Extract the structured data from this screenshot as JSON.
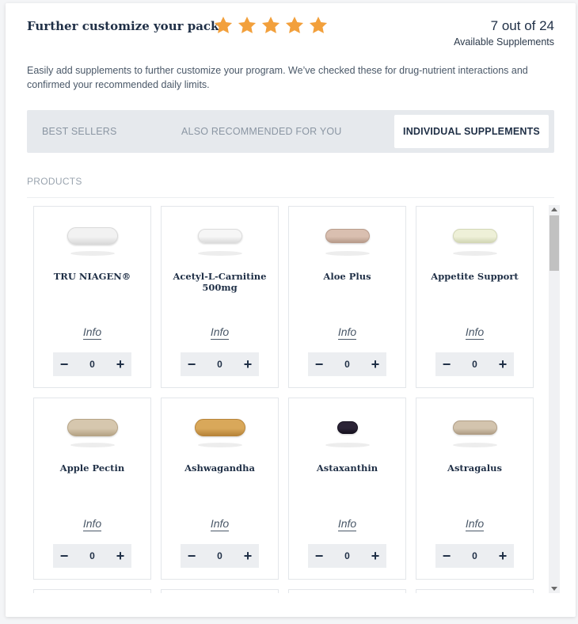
{
  "header": {
    "title": "Further customize your pack",
    "rating_stars": 5,
    "star_color": "#F2A03C",
    "count_main": "7 out of 24",
    "count_sub": "Available Supplements"
  },
  "intro": "Easily add supplements to further customize your program. We’ve checked these for drug-nutrient interactions and confirmed your recommended daily limits.",
  "tabs": [
    {
      "label": "BEST SELLERS",
      "active": false
    },
    {
      "label": "ALSO RECOMMENDED FOR YOU",
      "active": false
    },
    {
      "label": "INDIVIDUAL SUPPLEMENTS",
      "active": true
    }
  ],
  "products_label": "PRODUCTS",
  "products": [
    {
      "name": "TRU NIAGEN®",
      "info": "Info",
      "qty": "0",
      "pill_color": "#f2f2f2",
      "pill_edge": "#d9d9d9",
      "pill": "capsule-large"
    },
    {
      "name": "Acetyl-L-Carnitine 500mg",
      "info": "Info",
      "qty": "0",
      "pill_color": "#f6f6f6",
      "pill_edge": "#dcdcdc",
      "pill": "capsule"
    },
    {
      "name": "Aloe Plus",
      "info": "Info",
      "qty": "0",
      "pill_color": "#d9bfb0",
      "pill_edge": "#b89c8c",
      "pill": "capsule"
    },
    {
      "name": "Appetite Support",
      "info": "Info",
      "qty": "0",
      "pill_color": "#eef0d8",
      "pill_edge": "#d3d7b6",
      "pill": "capsule"
    },
    {
      "name": "Apple Pectin",
      "info": "Info",
      "qty": "0",
      "pill_color": "#d6c7ae",
      "pill_edge": "#b5a385",
      "pill": "capsule-large"
    },
    {
      "name": "Ashwagandha",
      "info": "Info",
      "qty": "0",
      "pill_color": "#d9a85a",
      "pill_edge": "#b7843a",
      "pill": "capsule-large"
    },
    {
      "name": "Astaxanthin",
      "info": "Info",
      "qty": "0",
      "pill_color": "#2b2336",
      "pill_edge": "#16111f",
      "pill": "softgel"
    },
    {
      "name": "Astragalus",
      "info": "Info",
      "qty": "0",
      "pill_color": "#d3c4ae",
      "pill_edge": "#b09e86",
      "pill": "capsule"
    }
  ]
}
